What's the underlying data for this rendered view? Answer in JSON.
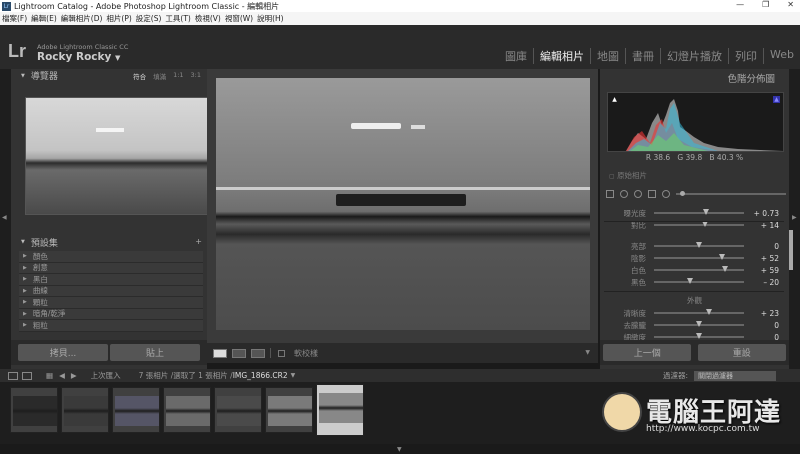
{
  "window": {
    "title": "Lightroom Catalog - Adobe Photoshop Lightroom Classic - 編輯相片",
    "icon": "Lr",
    "min": "—",
    "max": "❐",
    "close": "✕"
  },
  "menu": [
    "檔案(F)",
    "編輯(E)",
    "編輯相片(D)",
    "相片(P)",
    "設定(S)",
    "工具(T)",
    "檢視(V)",
    "視窗(W)",
    "說明(H)"
  ],
  "identity": {
    "logo": "Lr",
    "product": "Adobe Lightroom Classic CC",
    "user": "Rocky Rocky",
    "caret": "▼"
  },
  "modules": [
    "圖庫",
    "編輯相片",
    "地圖",
    "書冊",
    "幻燈片播放",
    "列印",
    "Web"
  ],
  "active_module": "編輯相片",
  "navigator": {
    "title": "導覽器",
    "zoom": [
      "符合",
      "填滿",
      "1:1",
      "3:1"
    ]
  },
  "presets": {
    "title": "預設集",
    "plus": "+",
    "items": [
      "顏色",
      "創意",
      "黑白",
      "曲線",
      "顆粒",
      "暗角/乾淨",
      "粗粒"
    ]
  },
  "left_buttons": {
    "copy": "拷貝...",
    "paste": "貼上"
  },
  "toolbar": {
    "soft_proof": "軟校樣"
  },
  "histogram": {
    "title": "色階分佈圖",
    "readout": {
      "r_label": "R",
      "r": "38.6",
      "g_label": "G",
      "g": "39.8",
      "b_label": "B",
      "b": "40.3",
      "unit": "%"
    },
    "original": "原始相片"
  },
  "adjustments": [
    {
      "label": "曝光度",
      "value": "+ 0.73",
      "pos": 0.58
    },
    {
      "label": "對比",
      "value": "+ 14",
      "pos": 0.57
    },
    {
      "label": "亮部",
      "value": "0",
      "pos": 0.5
    },
    {
      "label": "陰影",
      "value": "+ 52",
      "pos": 0.76
    },
    {
      "label": "白色",
      "value": "+ 59",
      "pos": 0.79
    },
    {
      "label": "黑色",
      "value": "– 20",
      "pos": 0.4
    },
    {
      "label": "清晰度",
      "value": "+ 23",
      "pos": 0.61
    },
    {
      "label": "去朦朧",
      "value": "0",
      "pos": 0.5
    },
    {
      "label": "細緻度",
      "value": "0",
      "pos": 0.5
    }
  ],
  "presence_title": "外觀",
  "right_buttons": {
    "previous": "上一個",
    "reset": "重設"
  },
  "filmstrip_bar": {
    "source": "上次匯入",
    "status": "7 張相片 /選取了 1 張相片 /",
    "filename": "IMG_1866.CR2",
    "filter_label": "過濾器:",
    "filter_value": "關閉過濾器"
  },
  "thumbnails": [
    {
      "bg": "#2a2a2a"
    },
    {
      "bg": "#3a3a3a"
    },
    {
      "bg": "#555566"
    },
    {
      "bg": "#6a6a6a"
    },
    {
      "bg": "#4a4a4a"
    },
    {
      "bg": "#7a7a7a"
    },
    {
      "bg": "#888888"
    }
  ],
  "watermark": {
    "text": "電腦王阿達",
    "url": "http://www.kocpc.com.tw"
  },
  "edge_arrows": {
    "left": "◀",
    "right": "▶",
    "bottom": "▼"
  }
}
